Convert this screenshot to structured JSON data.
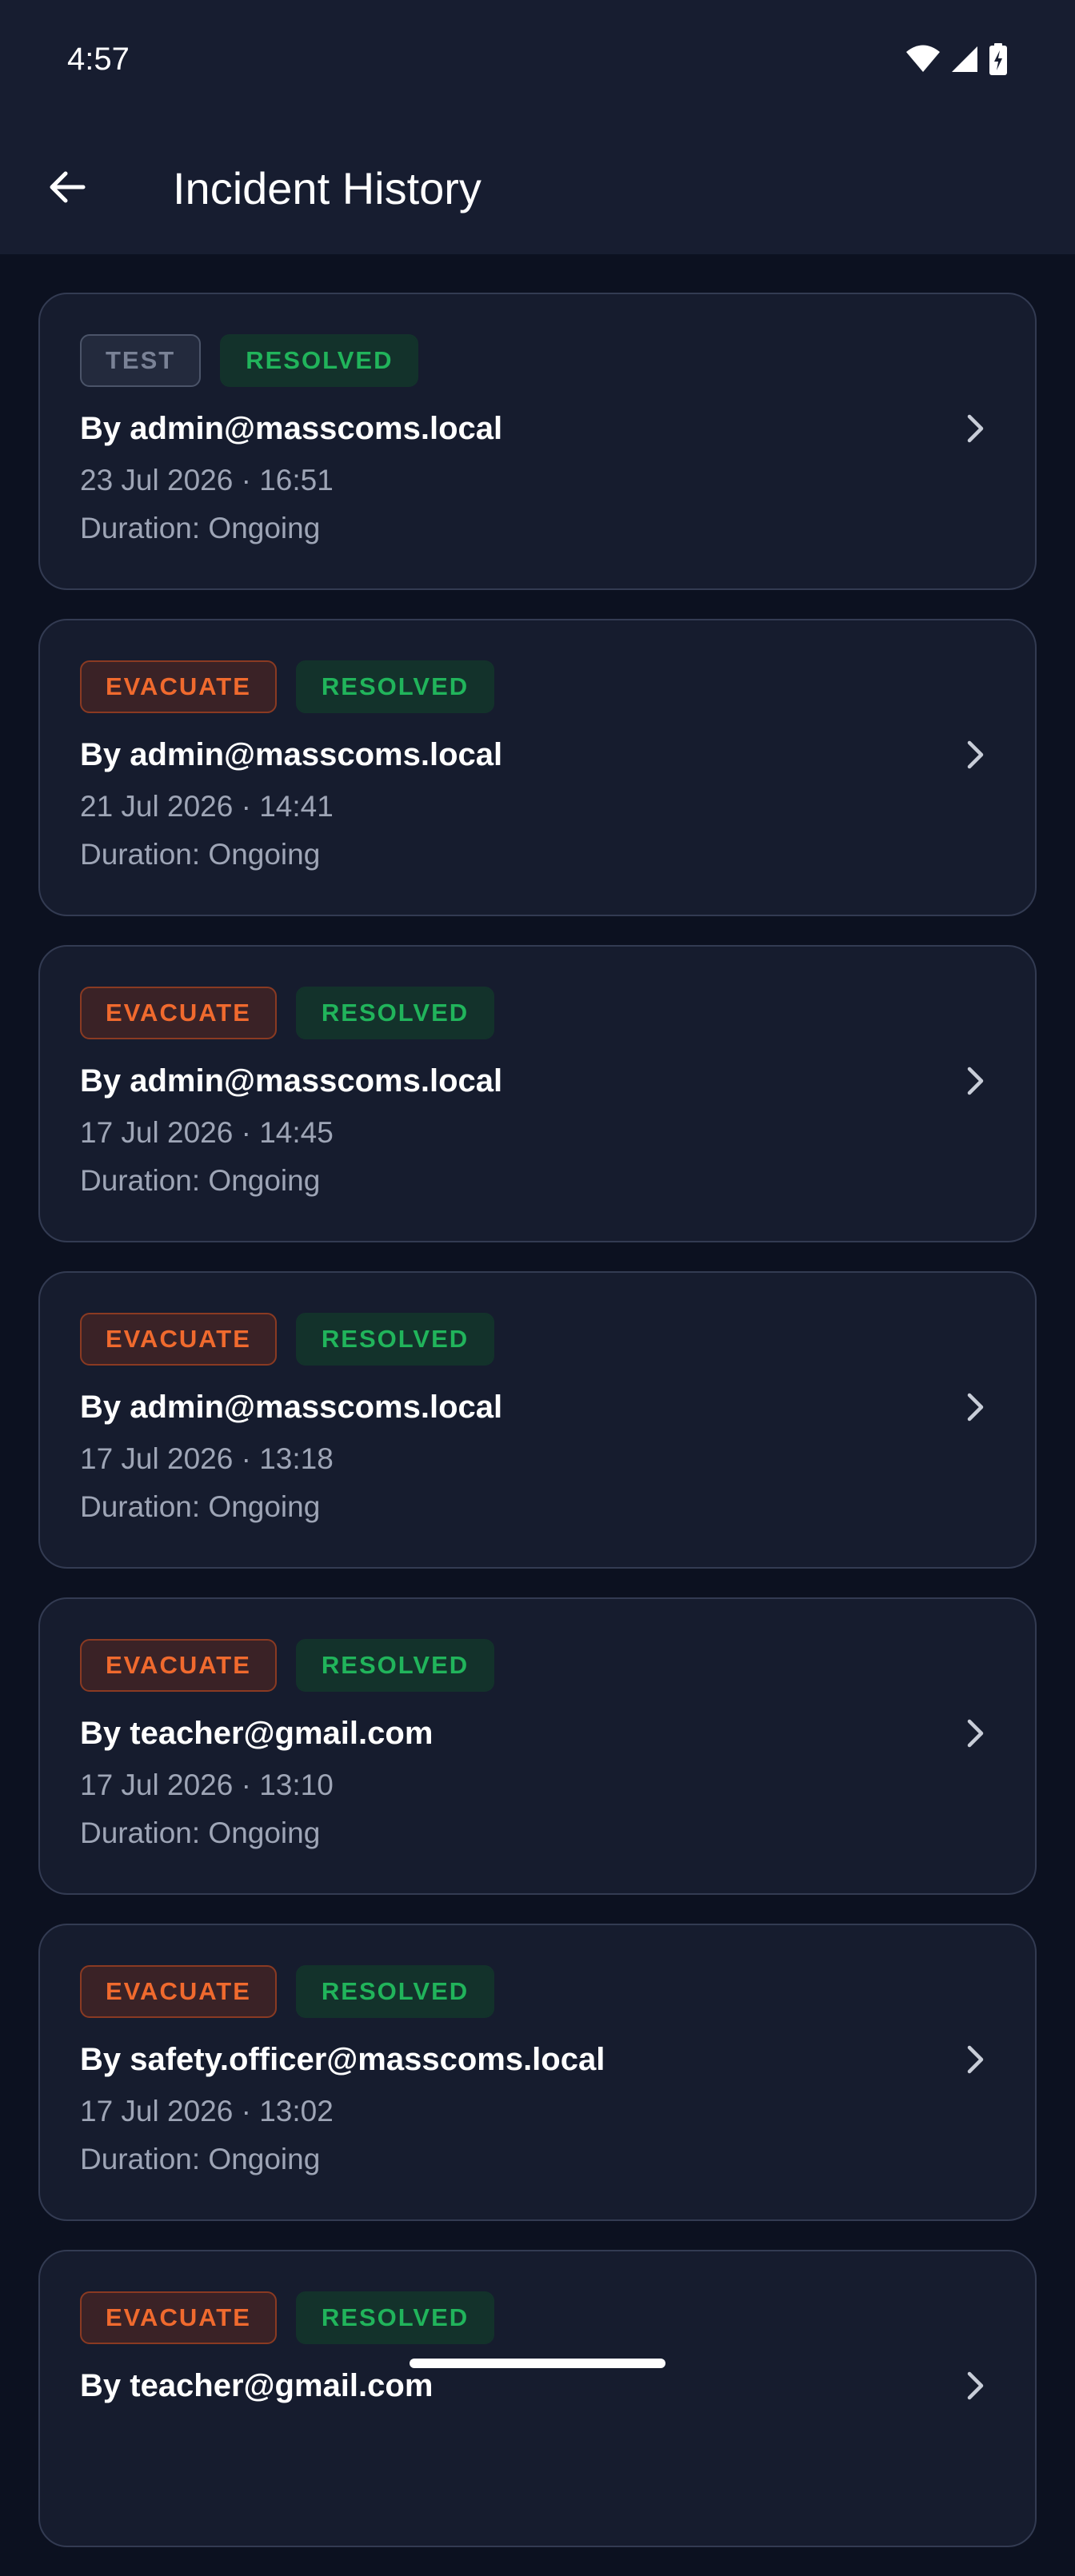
{
  "status_bar": {
    "time": "4:57",
    "icons": [
      "wifi-icon",
      "cell-signal-icon",
      "battery-charging-icon"
    ]
  },
  "header": {
    "back_icon": "arrow-left-icon",
    "title": "Incident History"
  },
  "colors": {
    "background": "#0c1120",
    "header": "#171d30",
    "card": "#161c2e",
    "card_border": "#333b52",
    "test_badge": "#7a8296",
    "evacuate_badge": "#f06a2e",
    "resolved_badge": "#21b45b",
    "muted_text": "#9ea5b6"
  },
  "incidents": [
    {
      "type": "TEST",
      "status": "RESOLVED",
      "author": "By admin@masscoms.local",
      "datetime": "23 Jul 2026 · 16:51",
      "duration": "Duration: Ongoing"
    },
    {
      "type": "EVACUATE",
      "status": "RESOLVED",
      "author": "By admin@masscoms.local",
      "datetime": "21 Jul 2026 · 14:41",
      "duration": "Duration: Ongoing"
    },
    {
      "type": "EVACUATE",
      "status": "RESOLVED",
      "author": "By admin@masscoms.local",
      "datetime": "17 Jul 2026 · 14:45",
      "duration": "Duration: Ongoing"
    },
    {
      "type": "EVACUATE",
      "status": "RESOLVED",
      "author": "By admin@masscoms.local",
      "datetime": "17 Jul 2026 · 13:18",
      "duration": "Duration: Ongoing"
    },
    {
      "type": "EVACUATE",
      "status": "RESOLVED",
      "author": "By teacher@gmail.com",
      "datetime": "17 Jul 2026 · 13:10",
      "duration": "Duration: Ongoing"
    },
    {
      "type": "EVACUATE",
      "status": "RESOLVED",
      "author": "By safety.officer@masscoms.local",
      "datetime": "17 Jul 2026 · 13:02",
      "duration": "Duration: Ongoing"
    },
    {
      "type": "EVACUATE",
      "status": "RESOLVED",
      "author": "By teacher@gmail.com",
      "datetime": "",
      "duration": ""
    }
  ]
}
